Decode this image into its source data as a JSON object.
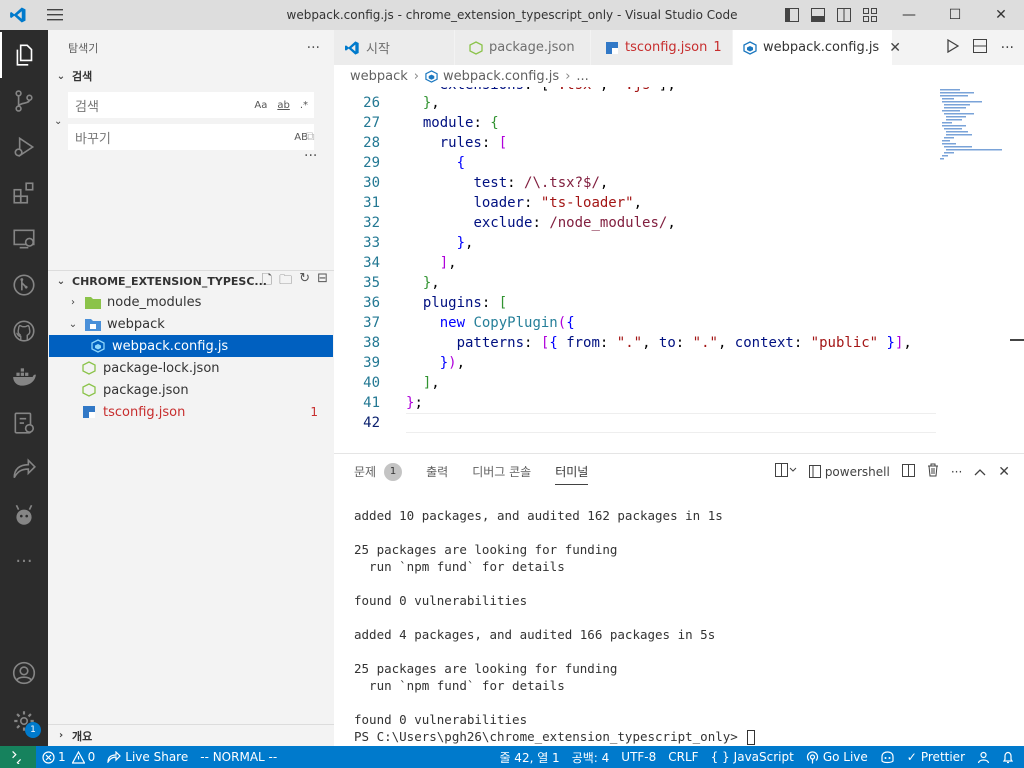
{
  "window": {
    "title": "webpack.config.js - chrome_extension_typescript_only - Visual Studio Code",
    "controls": {
      "minimize": "—",
      "maximize": "☐",
      "close": "✕"
    }
  },
  "activity_bar": {
    "items": [
      "explorer",
      "source-control",
      "run-debug",
      "extensions",
      "remote-explorer",
      "git-graph",
      "github",
      "docker",
      "gitlens",
      "live-share",
      "pets",
      "more"
    ],
    "more_label": "···",
    "settings_badge": "1"
  },
  "sidebar": {
    "title": "탐색기",
    "more": "···",
    "search": {
      "section_title": "검색",
      "search_placeholder": "검색",
      "replace_placeholder": "바꾸기",
      "opt_case": "Aa",
      "opt_word": "ab",
      "opt_regex": ".*",
      "opt_preserve": "AB"
    },
    "explorer": {
      "section_title": "CHROME_EXTENSION_TYPESC...",
      "items": [
        {
          "label": "node_modules",
          "type": "folder",
          "expanded": false
        },
        {
          "label": "webpack",
          "type": "folder",
          "expanded": true
        },
        {
          "label": "webpack.config.js",
          "type": "file",
          "selected": true
        },
        {
          "label": "package-lock.json",
          "type": "file"
        },
        {
          "label": "package.json",
          "type": "file"
        },
        {
          "label": "tsconfig.json",
          "type": "file",
          "error": true,
          "count": "1"
        }
      ]
    },
    "outline_title": "개요"
  },
  "tabs": [
    {
      "label": "시작",
      "active": false
    },
    {
      "label": "package.json",
      "active": false
    },
    {
      "label": "tsconfig.json",
      "active": false,
      "count": "1"
    },
    {
      "label": "webpack.config.js",
      "active": true
    }
  ],
  "breadcrumb": {
    "folder": "webpack",
    "file": "webpack.config.js",
    "more": "..."
  },
  "editor": {
    "line_numbers": [
      "26",
      "27",
      "28",
      "29",
      "30",
      "31",
      "32",
      "33",
      "34",
      "35",
      "36",
      "37",
      "38",
      "39",
      "40",
      "41",
      "42"
    ],
    "current_line": "42"
  },
  "panel": {
    "tabs": {
      "problems": "문제",
      "problems_count": "1",
      "output": "출력",
      "debug_console": "디버그 콘솔",
      "terminal": "터미널"
    },
    "shell": "powershell",
    "terminal_lines": [
      "added 10 packages, and audited 162 packages in 1s",
      "",
      "25 packages are looking for funding",
      "  run `npm fund` for details",
      "",
      "found 0 vulnerabilities",
      "",
      "added 4 packages, and audited 166 packages in 5s",
      "",
      "25 packages are looking for funding",
      "  run `npm fund` for details",
      "",
      "found 0 vulnerabilities"
    ],
    "prompt": "PS C:\\Users\\pgh26\\chrome_extension_typescript_only> "
  },
  "statusbar": {
    "errors": "1",
    "warnings": "0",
    "live_share": "Live Share",
    "vim_mode": "-- NORMAL --",
    "position": "줄 42, 열 1",
    "spaces": "공백: 4",
    "encoding": "UTF-8",
    "eol": "CRLF",
    "language": "JavaScript",
    "go_live": "Go Live",
    "prettier": "Prettier"
  },
  "colors": {
    "accent": "#007acc",
    "activity_bg": "#2c2c2c",
    "selection": "#0060c0",
    "error": "#c72e2e"
  }
}
